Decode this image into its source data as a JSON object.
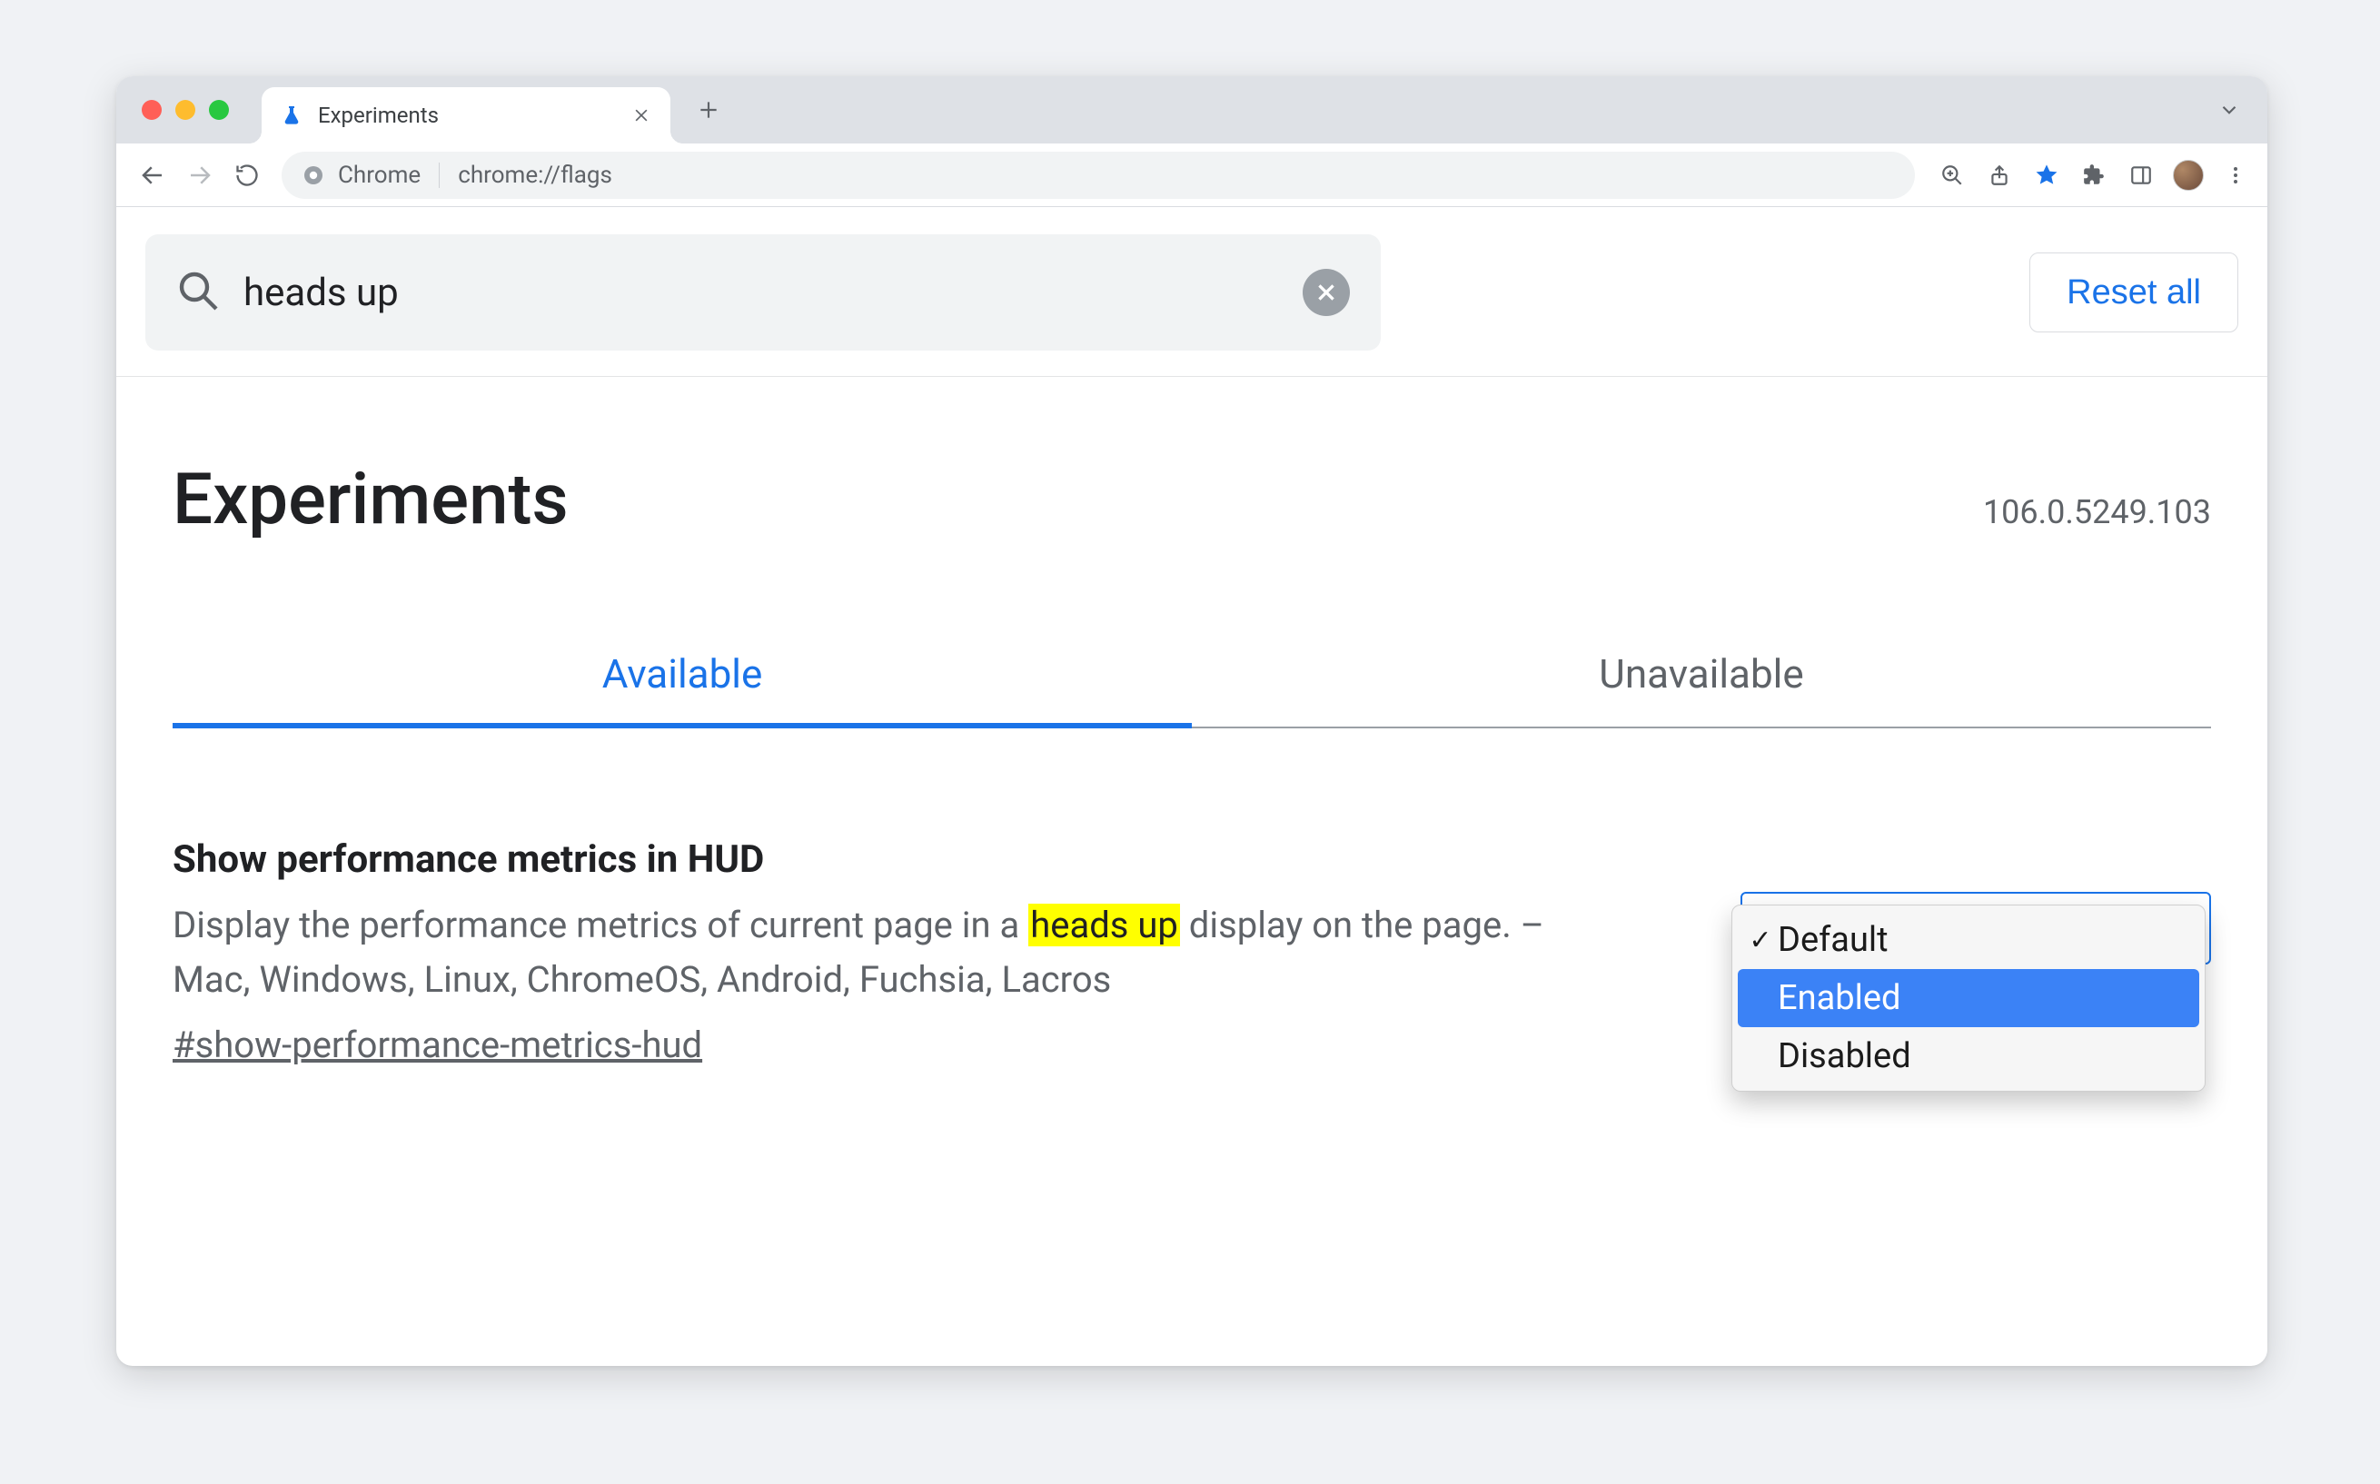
{
  "window": {
    "tab_title": "Experiments",
    "address_label": "Chrome",
    "address_url": "chrome://flags"
  },
  "search": {
    "value": "heads up",
    "reset_label": "Reset all"
  },
  "header": {
    "title": "Experiments",
    "version": "106.0.5249.103"
  },
  "tabs": {
    "available": "Available",
    "unavailable": "Unavailable"
  },
  "experiment": {
    "title": "Show performance metrics in HUD",
    "desc_before": "Display the performance metrics of current page in a ",
    "desc_highlight": "heads up",
    "desc_after": " display on the page. – Mac, Windows, Linux, ChromeOS, Android, Fuchsia, Lacros",
    "anchor": "#show-performance-metrics-hud",
    "options": {
      "default": "Default",
      "enabled": "Enabled",
      "disabled": "Disabled"
    }
  }
}
